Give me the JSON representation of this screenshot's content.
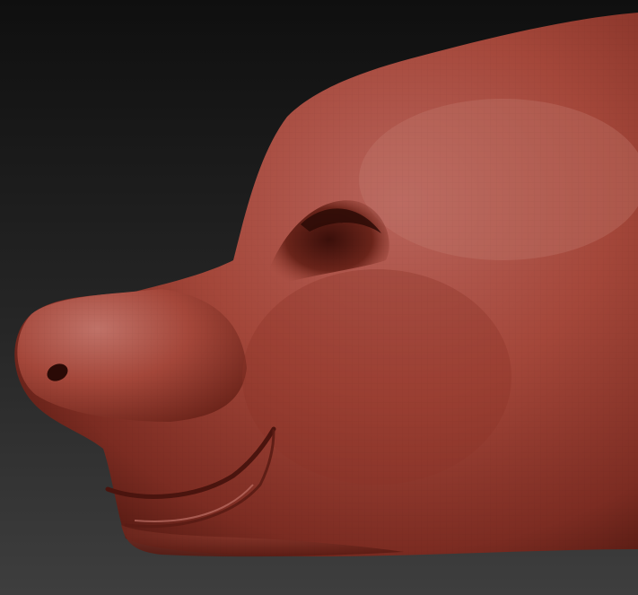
{
  "scene": {
    "subject": "sculpted-animal-head",
    "material_color": "#a8483a",
    "highlight_color": "#c97b70",
    "shadow_color": "#5e1e16",
    "background_top": "#111111",
    "background_bottom": "#3c3c3c"
  }
}
